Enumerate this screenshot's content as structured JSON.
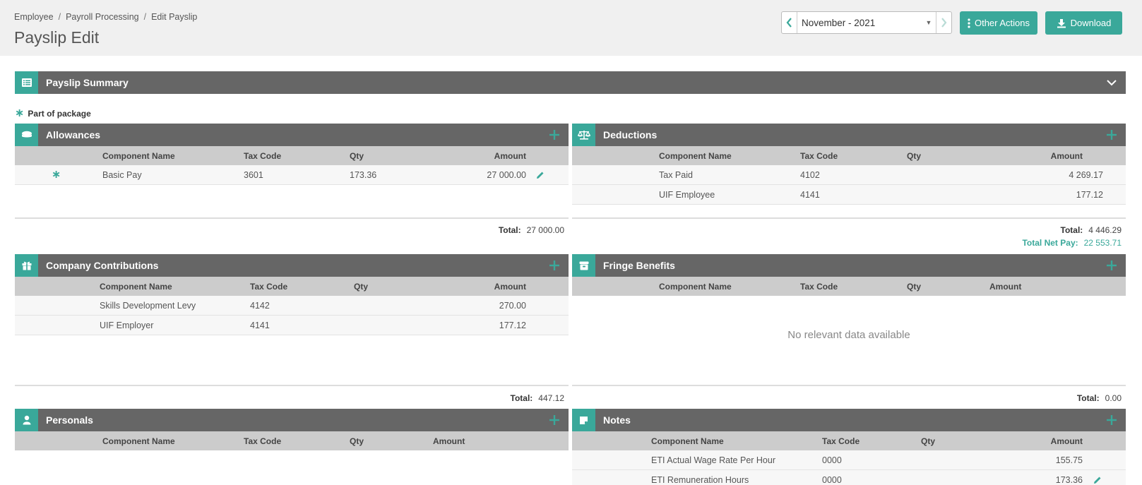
{
  "breadcrumb": [
    "Employee",
    "Payroll Processing",
    "Edit Payslip"
  ],
  "page_title": "Payslip Edit",
  "period": "November - 2021",
  "actions": {
    "other": "Other Actions",
    "download": "Download"
  },
  "summary": {
    "title": "Payslip Summary"
  },
  "legend": "Part of package",
  "colors": {
    "accent": "#3aa89a",
    "header": "#666666",
    "table_head": "#cccccc"
  },
  "allowances": {
    "title": "Allowances",
    "columns": [
      "Component Name",
      "Tax Code",
      "Qty",
      "Amount"
    ],
    "rows": [
      {
        "name": "Basic Pay",
        "code": "3601",
        "qty": "173.36",
        "amount": "27 000.00"
      }
    ],
    "total_label": "Total:",
    "total": "27 000.00"
  },
  "deductions": {
    "title": "Deductions",
    "columns": [
      "Component Name",
      "Tax Code",
      "Qty",
      "Amount"
    ],
    "rows": [
      {
        "name": "Tax Paid",
        "code": "4102",
        "qty": "",
        "amount": "4 269.17"
      },
      {
        "name": "UIF Employee",
        "code": "4141",
        "qty": "",
        "amount": "177.12"
      }
    ],
    "total_label": "Total:",
    "total": "4 446.29",
    "net_label": "Total Net Pay:",
    "net": "22 553.71"
  },
  "contributions": {
    "title": "Company Contributions",
    "columns": [
      "Component Name",
      "Tax Code",
      "Qty",
      "Amount"
    ],
    "rows": [
      {
        "name": "Skills Development Levy",
        "code": "4142",
        "qty": "",
        "amount": "270.00"
      },
      {
        "name": "UIF Employer",
        "code": "4141",
        "qty": "",
        "amount": "177.12"
      }
    ],
    "total_label": "Total:",
    "total": "447.12"
  },
  "fringe": {
    "title": "Fringe Benefits",
    "columns": [
      "Component Name",
      "Tax Code",
      "Qty",
      "Amount"
    ],
    "empty": "No relevant data available",
    "total_label": "Total:",
    "total": "0.00"
  },
  "personals": {
    "title": "Personals",
    "columns": [
      "Component Name",
      "Tax Code",
      "Qty",
      "Amount"
    ]
  },
  "notes": {
    "title": "Notes",
    "columns": [
      "Component Name",
      "Tax Code",
      "Qty",
      "Amount"
    ],
    "rows": [
      {
        "name": "ETI Actual Wage Rate Per Hour",
        "code": "0000",
        "qty": "",
        "amount": "155.75"
      },
      {
        "name": "ETI Remuneration Hours",
        "code": "0000",
        "qty": "",
        "amount": "173.36"
      }
    ]
  }
}
